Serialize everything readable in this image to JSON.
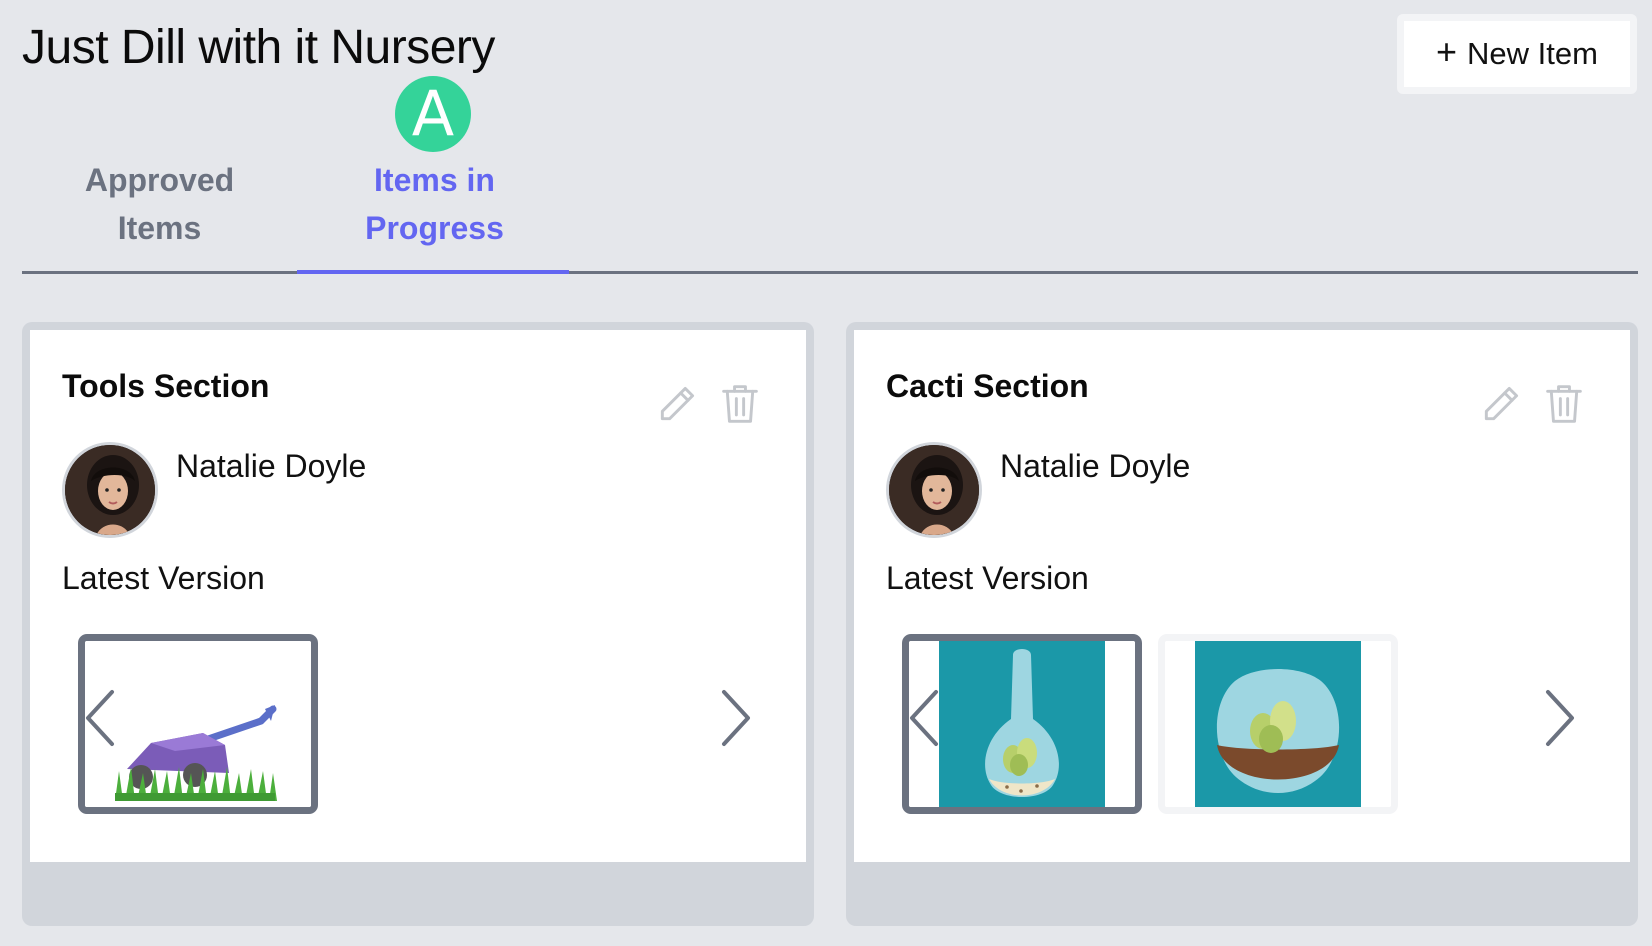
{
  "app": {
    "title": "Just Dill with it Nursery"
  },
  "header": {
    "new_item_label": "New Item",
    "new_item_icon": "plus-icon"
  },
  "tabs": [
    {
      "label": "Approved Items",
      "active": false
    },
    {
      "label": "Items in Progress",
      "active": true,
      "badge_letter": "A"
    }
  ],
  "colors": {
    "accent": "#6366f1",
    "badge": "#34d399",
    "muted": "#6b7280",
    "background": "#e5e7eb"
  },
  "cards": [
    {
      "title": "Tools Section",
      "author": "Natalie Doyle",
      "version_label": "Latest Version",
      "thumbnails": [
        "lawn-mower-image"
      ]
    },
    {
      "title": "Cacti Section",
      "author": "Natalie Doyle",
      "version_label": "Latest Version",
      "thumbnails": [
        "terrarium-bottle-image",
        "terrarium-bowl-image"
      ]
    }
  ]
}
